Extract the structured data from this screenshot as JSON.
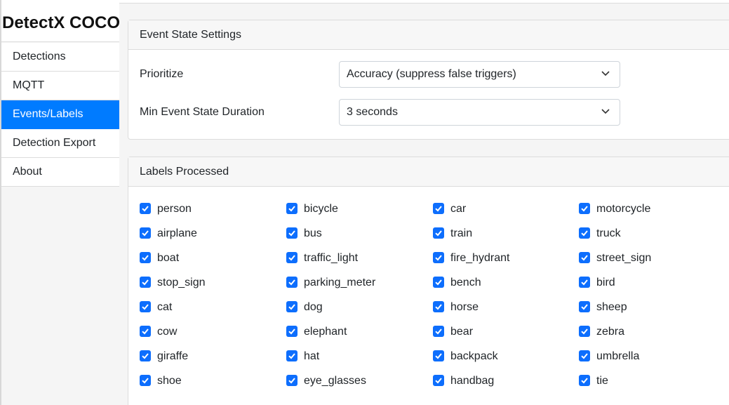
{
  "sidebar": {
    "title": "DetectX COCO",
    "items": [
      {
        "label": "Detections",
        "active": false
      },
      {
        "label": "MQTT",
        "active": false
      },
      {
        "label": "Events/Labels",
        "active": true
      },
      {
        "label": "Detection Export",
        "active": false
      },
      {
        "label": "About",
        "active": false
      }
    ]
  },
  "event_settings": {
    "header": "Event State Settings",
    "prioritize": {
      "label": "Prioritize",
      "value": "Accuracy (suppress false triggers)"
    },
    "min_duration": {
      "label": "Min Event State Duration",
      "value": "3 seconds"
    }
  },
  "labels": {
    "header": "Labels Processed",
    "items": [
      {
        "name": "person",
        "checked": true
      },
      {
        "name": "bicycle",
        "checked": true
      },
      {
        "name": "car",
        "checked": true
      },
      {
        "name": "motorcycle",
        "checked": true
      },
      {
        "name": "airplane",
        "checked": true
      },
      {
        "name": "bus",
        "checked": true
      },
      {
        "name": "train",
        "checked": true
      },
      {
        "name": "truck",
        "checked": true
      },
      {
        "name": "boat",
        "checked": true
      },
      {
        "name": "traffic_light",
        "checked": true
      },
      {
        "name": "fire_hydrant",
        "checked": true
      },
      {
        "name": "street_sign",
        "checked": true
      },
      {
        "name": "stop_sign",
        "checked": true
      },
      {
        "name": "parking_meter",
        "checked": true
      },
      {
        "name": "bench",
        "checked": true
      },
      {
        "name": "bird",
        "checked": true
      },
      {
        "name": "cat",
        "checked": true
      },
      {
        "name": "dog",
        "checked": true
      },
      {
        "name": "horse",
        "checked": true
      },
      {
        "name": "sheep",
        "checked": true
      },
      {
        "name": "cow",
        "checked": true
      },
      {
        "name": "elephant",
        "checked": true
      },
      {
        "name": "bear",
        "checked": true
      },
      {
        "name": "zebra",
        "checked": true
      },
      {
        "name": "giraffe",
        "checked": true
      },
      {
        "name": "hat",
        "checked": true
      },
      {
        "name": "backpack",
        "checked": true
      },
      {
        "name": "umbrella",
        "checked": true
      },
      {
        "name": "shoe",
        "checked": true
      },
      {
        "name": "eye_glasses",
        "checked": true
      },
      {
        "name": "handbag",
        "checked": true
      },
      {
        "name": "tie",
        "checked": true
      }
    ]
  },
  "colors": {
    "accent": "#007bff",
    "checkbox": "#0d6efd"
  }
}
